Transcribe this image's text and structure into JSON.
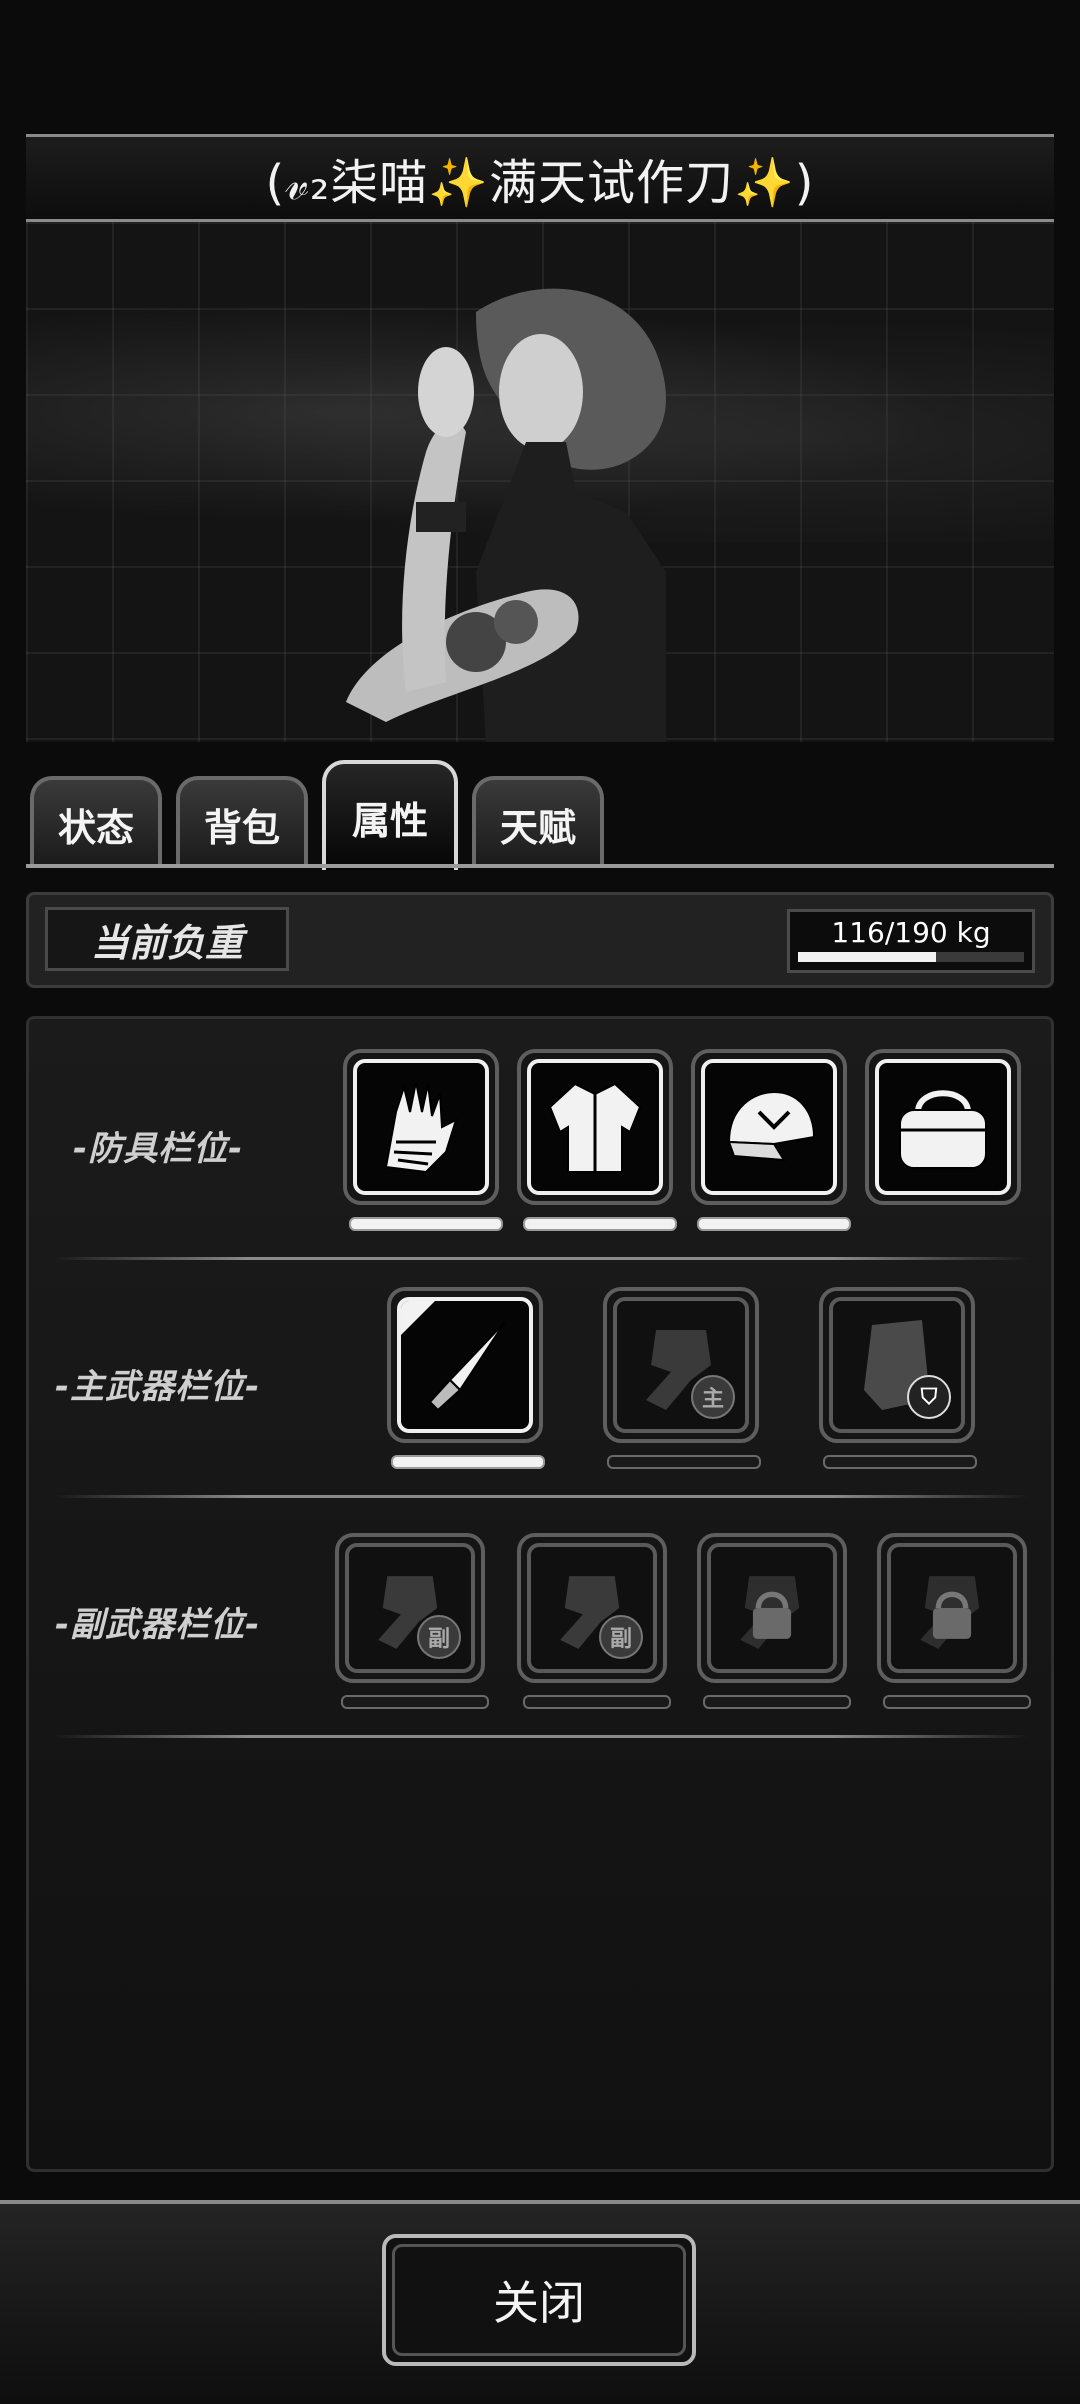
{
  "header": {
    "title": "(𝓋₂柒喵✨满天试作刀✨)"
  },
  "tabs": [
    {
      "label": "状态",
      "active": false
    },
    {
      "label": "背包",
      "active": false
    },
    {
      "label": "属性",
      "active": true
    },
    {
      "label": "天赋",
      "active": false
    }
  ],
  "weight": {
    "label": "当前负重",
    "value_text": "116/190 kg",
    "current": 116,
    "max": 190
  },
  "rows": {
    "armor": {
      "label": "-防具栏位-",
      "slots": [
        "gloves-icon",
        "jacket-icon",
        "cap-icon",
        "bag-icon"
      ]
    },
    "primary": {
      "label": "-主武器栏位-",
      "slots": [
        "knife-icon",
        "fist-icon",
        "riot-shield-icon"
      ],
      "badge_main": "主"
    },
    "secondary": {
      "label": "-副武器栏位-",
      "slots": [
        "fist-icon",
        "fist-icon",
        "locked-fist-icon",
        "locked-fist-icon"
      ],
      "badge_sub": "副"
    }
  },
  "footer": {
    "close_label": "关闭"
  },
  "colors": {
    "background": "#0b0b0b",
    "accent": "#f2f2f2",
    "panel": "#1b1b1b"
  }
}
